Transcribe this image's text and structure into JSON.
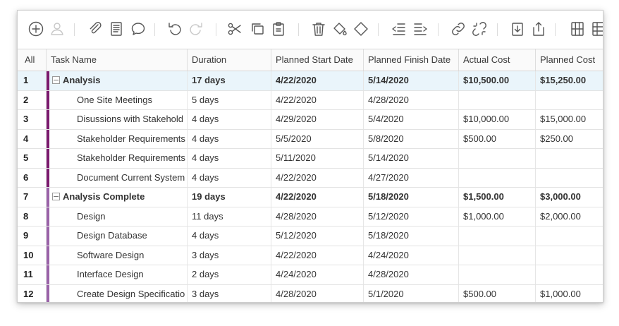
{
  "toolbar": {
    "icons": [
      {
        "name": "add-icon",
        "enabled": true
      },
      {
        "name": "resource-user-icon",
        "enabled": false
      },
      {
        "name": "attachment-icon",
        "enabled": true
      },
      {
        "name": "notes-icon",
        "enabled": true
      },
      {
        "name": "comment-icon",
        "enabled": true
      },
      {
        "name": "undo-icon",
        "enabled": true
      },
      {
        "name": "redo-icon",
        "enabled": false
      },
      {
        "name": "cut-icon",
        "enabled": true
      },
      {
        "name": "copy-icon",
        "enabled": true
      },
      {
        "name": "paste-icon",
        "enabled": true
      },
      {
        "name": "delete-icon",
        "enabled": true
      },
      {
        "name": "fill-color-icon",
        "enabled": true
      },
      {
        "name": "clear-format-icon",
        "enabled": true
      },
      {
        "name": "outdent-icon",
        "enabled": true
      },
      {
        "name": "indent-icon",
        "enabled": true
      },
      {
        "name": "link-icon",
        "enabled": true
      },
      {
        "name": "unlink-icon",
        "enabled": true
      },
      {
        "name": "import-icon",
        "enabled": true
      },
      {
        "name": "export-icon",
        "enabled": true
      },
      {
        "name": "columns-icon",
        "enabled": true
      },
      {
        "name": "table-icon",
        "enabled": true
      }
    ]
  },
  "grid": {
    "headers": {
      "all": "All",
      "task_name": "Task Name",
      "duration": "Duration",
      "planned_start": "Planned Start Date",
      "planned_finish": "Planned Finish Date",
      "actual_cost": "Actual Cost",
      "planned_cost": "Planned Cost"
    },
    "colors": {
      "dark_bar": "#7b1a6e",
      "light_bar": "#9a62a8",
      "selected_row": "#eaf5fb"
    },
    "rows": [
      {
        "id": "1",
        "task": "Analysis",
        "duration": "17 days",
        "start": "4/22/2020",
        "finish": "5/14/2020",
        "actual_cost": "$10,500.00",
        "planned_cost": "$15,250.00",
        "summary": true,
        "selected": true,
        "bar": "dark"
      },
      {
        "id": "2",
        "task": "One Site Meetings",
        "duration": "5 days",
        "start": "4/22/2020",
        "finish": "4/28/2020",
        "actual_cost": "",
        "planned_cost": "",
        "summary": false,
        "selected": false,
        "bar": "dark"
      },
      {
        "id": "3",
        "task": "Disussions with Stakehold",
        "duration": "4 days",
        "start": "4/29/2020",
        "finish": "5/4/2020",
        "actual_cost": "$10,000.00",
        "planned_cost": "$15,000.00",
        "summary": false,
        "selected": false,
        "bar": "dark"
      },
      {
        "id": "4",
        "task": "Stakeholder Requirements",
        "duration": "4 days",
        "start": "5/5/2020",
        "finish": "5/8/2020",
        "actual_cost": "$500.00",
        "planned_cost": "$250.00",
        "summary": false,
        "selected": false,
        "bar": "dark"
      },
      {
        "id": "5",
        "task": "Stakeholder Requirements",
        "duration": "4 days",
        "start": "5/11/2020",
        "finish": "5/14/2020",
        "actual_cost": "",
        "planned_cost": "",
        "summary": false,
        "selected": false,
        "bar": "dark"
      },
      {
        "id": "6",
        "task": "Document Current System",
        "duration": "4 days",
        "start": "4/22/2020",
        "finish": "4/27/2020",
        "actual_cost": "",
        "planned_cost": "",
        "summary": false,
        "selected": false,
        "bar": "dark"
      },
      {
        "id": "7",
        "task": "Analysis Complete",
        "duration": "19 days",
        "start": "4/22/2020",
        "finish": "5/18/2020",
        "actual_cost": "$1,500.00",
        "planned_cost": "$3,000.00",
        "summary": true,
        "selected": false,
        "bar": "light"
      },
      {
        "id": "8",
        "task": "Design",
        "duration": "11 days",
        "start": "4/28/2020",
        "finish": "5/12/2020",
        "actual_cost": "$1,000.00",
        "planned_cost": "$2,000.00",
        "summary": false,
        "selected": false,
        "bar": "light"
      },
      {
        "id": "9",
        "task": "Design Database",
        "duration": "4 days",
        "start": "5/12/2020",
        "finish": "5/18/2020",
        "actual_cost": "",
        "planned_cost": "",
        "summary": false,
        "selected": false,
        "bar": "light"
      },
      {
        "id": "10",
        "task": "Software Design",
        "duration": "3 days",
        "start": "4/22/2020",
        "finish": "4/24/2020",
        "actual_cost": "",
        "planned_cost": "",
        "summary": false,
        "selected": false,
        "bar": "light"
      },
      {
        "id": "11",
        "task": "Interface Design",
        "duration": "2 days",
        "start": "4/24/2020",
        "finish": "4/28/2020",
        "actual_cost": "",
        "planned_cost": "",
        "summary": false,
        "selected": false,
        "bar": "light"
      },
      {
        "id": "12",
        "task": "Create Design Specificatio",
        "duration": "3 days",
        "start": "4/28/2020",
        "finish": "5/1/2020",
        "actual_cost": "$500.00",
        "planned_cost": "$1,000.00",
        "summary": false,
        "selected": false,
        "bar": "light"
      }
    ]
  }
}
